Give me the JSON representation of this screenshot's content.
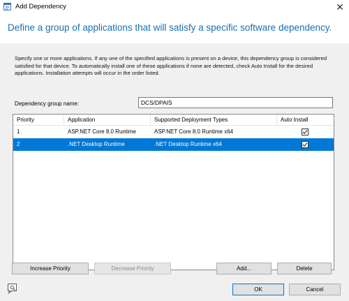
{
  "window": {
    "title": "Add Dependency",
    "close_glyph": "✕"
  },
  "header": {
    "heading": "Define a group of applications that will satisfy a specific software dependency."
  },
  "description": "Specify one or more applications. If any one of the specified applications is present on a device, this dependency group is considered satisfied for that device. To automatically install one of these applications if none are detected, check Auto Install for the desired applications. Installation attempts will occur in the order listed.",
  "group": {
    "label": "Dependency group name:",
    "value": "DCS/DPAIS"
  },
  "grid": {
    "columns": [
      "Priority",
      "Application",
      "Supported Deployment Types",
      "Auto Install"
    ],
    "rows": [
      {
        "priority": "1",
        "application": "ASP.NET Core 8.0 Runtime",
        "deployment_type": "ASP.NET Core 8.0 Runtime x64",
        "auto_install": true,
        "selected": false
      },
      {
        "priority": "2",
        "application": ".NET Desktop Runtime",
        "deployment_type": ".NET Desktop Runtime x64",
        "auto_install": true,
        "selected": true
      }
    ],
    "selection_color": "#0078d7"
  },
  "buttons": {
    "increase_priority": "Increase Priority",
    "decrease_priority": "Decrease Priority",
    "add": "Add...",
    "delete": "Delete",
    "ok": "OK",
    "cancel": "Cancel"
  },
  "accent_color": "#1a6fb0"
}
